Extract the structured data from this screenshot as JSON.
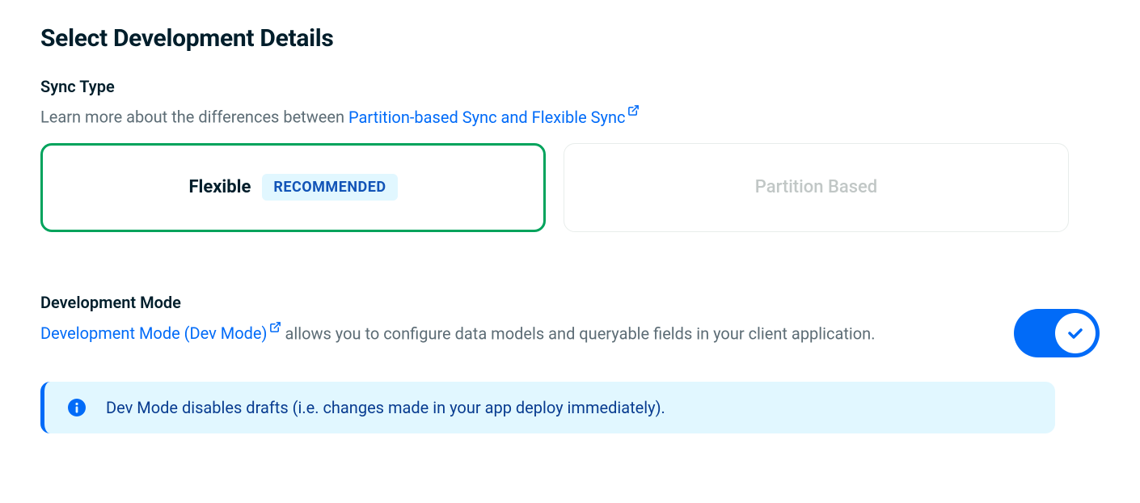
{
  "title": "Select Development Details",
  "syncType": {
    "label": "Sync Type",
    "descriptionPrefix": "Learn more about the differences between ",
    "linkText": "Partition-based Sync and Flexible Sync",
    "options": {
      "flexible": {
        "label": "Flexible",
        "badge": "RECOMMENDED",
        "selected": true
      },
      "partition": {
        "label": "Partition Based",
        "selected": false
      }
    }
  },
  "devMode": {
    "label": "Development Mode",
    "linkText": "Development Mode (Dev Mode)",
    "descriptionSuffix": "  allows you to configure data models and queryable fields in your client application.",
    "enabled": true
  },
  "infoBanner": {
    "text": "Dev Mode disables drafts (i.e. changes made in your app deploy immediately)."
  }
}
